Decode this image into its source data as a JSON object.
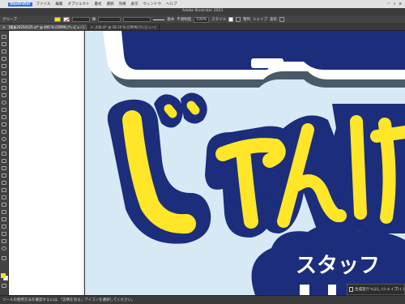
{
  "menubar": {
    "app_name": "Illustrator",
    "items": [
      "ファイル",
      "編集",
      "オブジェクト",
      "書式",
      "選択",
      "効果",
      "表示",
      "ウィンドウ",
      "ヘルプ"
    ]
  },
  "window": {
    "title": "Adobe Illustrator 2023"
  },
  "control_bar": {
    "selection_label": "グループ",
    "stroke_label": "線",
    "profile_label": "基本",
    "opacity_label": "不透明度",
    "opacity_value": "100%",
    "style_label": "スタイル",
    "align_label": "整列",
    "shape_label": "シェイプ",
    "transform_label": "変形"
  },
  "tabs": [
    {
      "label": "【看板20250125.ai* @ 400 % (CMYK/プレビュー)",
      "active": true
    },
    {
      "label": "大判.ai* @ 18.14 % (CMYK/プレビュー)",
      "active": false
    }
  ],
  "status": {
    "text": "ツールの使用方法を確認するには、「説明を見る」アイコンを選択してください。"
  },
  "layer_panel": {
    "label": "生成塗りつぶし (シェイプ) ( )"
  },
  "artwork": {
    "text_large": "じゃんけ",
    "text_small": "スタッフ",
    "colors": {
      "background": "#d8e9f6",
      "navy": "#1c2d7c",
      "yellow": "#ffe629",
      "shadow": "#4a5968",
      "white": "#ffffff"
    }
  }
}
